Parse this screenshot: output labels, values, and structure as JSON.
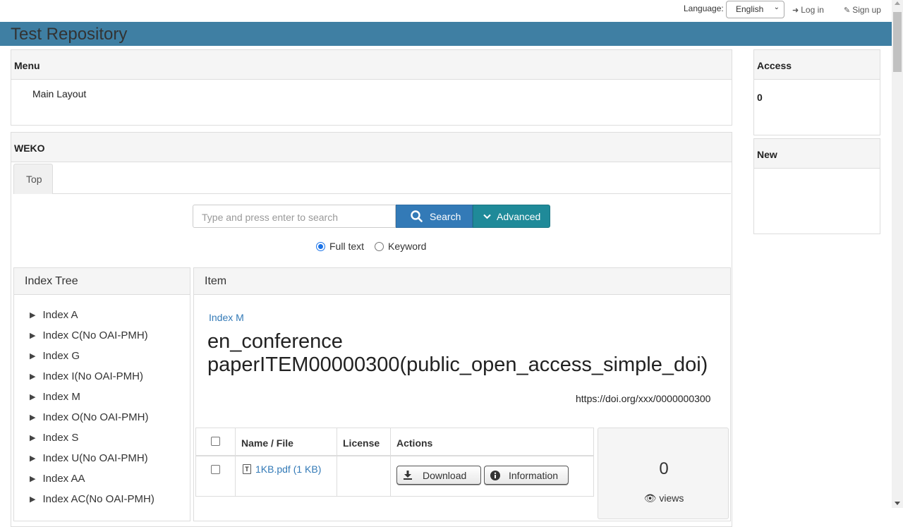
{
  "topbar": {
    "language_label": "Language:",
    "language_value": "English",
    "login": "Log in",
    "signup": "Sign up"
  },
  "banner": {
    "title": "Test Repository"
  },
  "menu": {
    "heading": "Menu",
    "items": [
      "Main Layout"
    ]
  },
  "access": {
    "heading": "Access",
    "value": "0"
  },
  "new_panel": {
    "heading": "New"
  },
  "weko": {
    "heading": "WEKO",
    "tabs": [
      "Top"
    ],
    "search": {
      "placeholder": "Type and press enter to search",
      "search_label": "Search",
      "advanced_label": "Advanced",
      "modes": [
        "Full text",
        "Keyword"
      ],
      "selected_mode": "Full text"
    }
  },
  "index_tree": {
    "heading": "Index Tree",
    "items": [
      "Index A",
      "Index C(No OAI-PMH)",
      "Index G",
      "Index I(No OAI-PMH)",
      "Index M",
      "Index O(No OAI-PMH)",
      "Index S",
      "Index U(No OAI-PMH)",
      "Index AA",
      "Index AC(No OAI-PMH)"
    ]
  },
  "item": {
    "heading": "Item",
    "index_link": "Index M",
    "title": "en_conference paperITEM00000300(public_open_access_simple_doi)",
    "doi": "https://doi.org/xxx/0000000300",
    "file_table": {
      "columns": [
        "Name / File",
        "License",
        "Actions"
      ],
      "rows": [
        {
          "file": "1KB.pdf (1 KB)",
          "license": "",
          "download": "Download",
          "information": "Information"
        }
      ]
    },
    "views": {
      "count": "0",
      "label": "views"
    }
  }
}
